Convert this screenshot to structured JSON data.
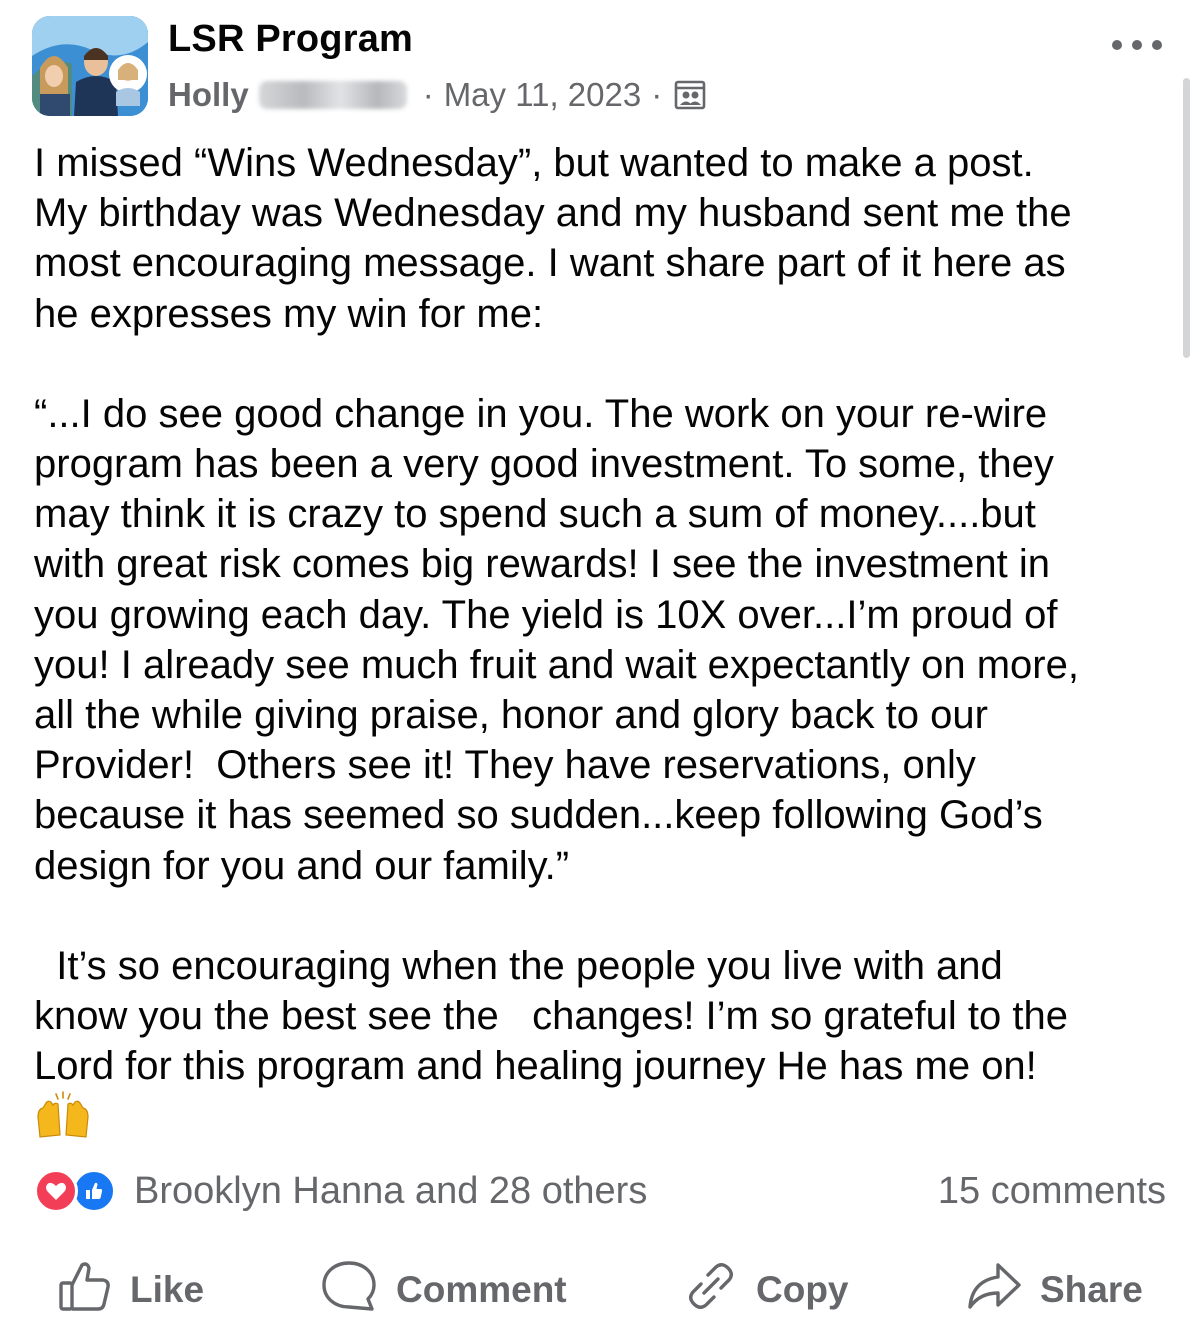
{
  "header": {
    "group_name": "LSR Program",
    "author": "Holly",
    "separator": "·",
    "date": "May 11, 2023",
    "privacy_icon": "members-icon",
    "more_icon": "more-horizontal-icon"
  },
  "body": {
    "paragraphs": [
      "I missed “Wins Wednesday”, but wanted to make a post.\nMy birthday was Wednesday and my husband sent me the\nmost encouraging message. I want share part of it here as\nhe expresses my win for me:",
      "“...I do see good change in you. The work on your re-wire\nprogram has been a very good investment. To some, they\nmay think it is crazy to spend such a sum of money....but\nwith great risk comes big rewards! I see the investment in\nyou growing each day. The yield is 10X over...I’m proud of\nyou! I already see much fruit and wait expectantly on more,\nall the while giving praise, honor and glory back to our\nProvider!  Others see it! They have reservations, only\nbecause it has seemed so sudden...keep following God’s\ndesign for you and our family.”",
      "  It’s so encouraging when the people you live with and\nknow you the best see the   changes! I’m so grateful to the\nLord for this program and healing journey He has me on!"
    ],
    "emoji": "raising-hands-emoji"
  },
  "reactions": {
    "icons": [
      "love-reaction-icon",
      "like-reaction-icon"
    ],
    "summary": "Brooklyn Hanna and 28 others",
    "comments": "15 comments"
  },
  "actions": {
    "like": "Like",
    "comment": "Comment",
    "copy": "Copy",
    "share": "Share"
  },
  "colors": {
    "text": "#050505",
    "secondary": "#65676b",
    "love": "#f33e58",
    "like": "#1877f2",
    "emoji": "#f5b81c"
  }
}
